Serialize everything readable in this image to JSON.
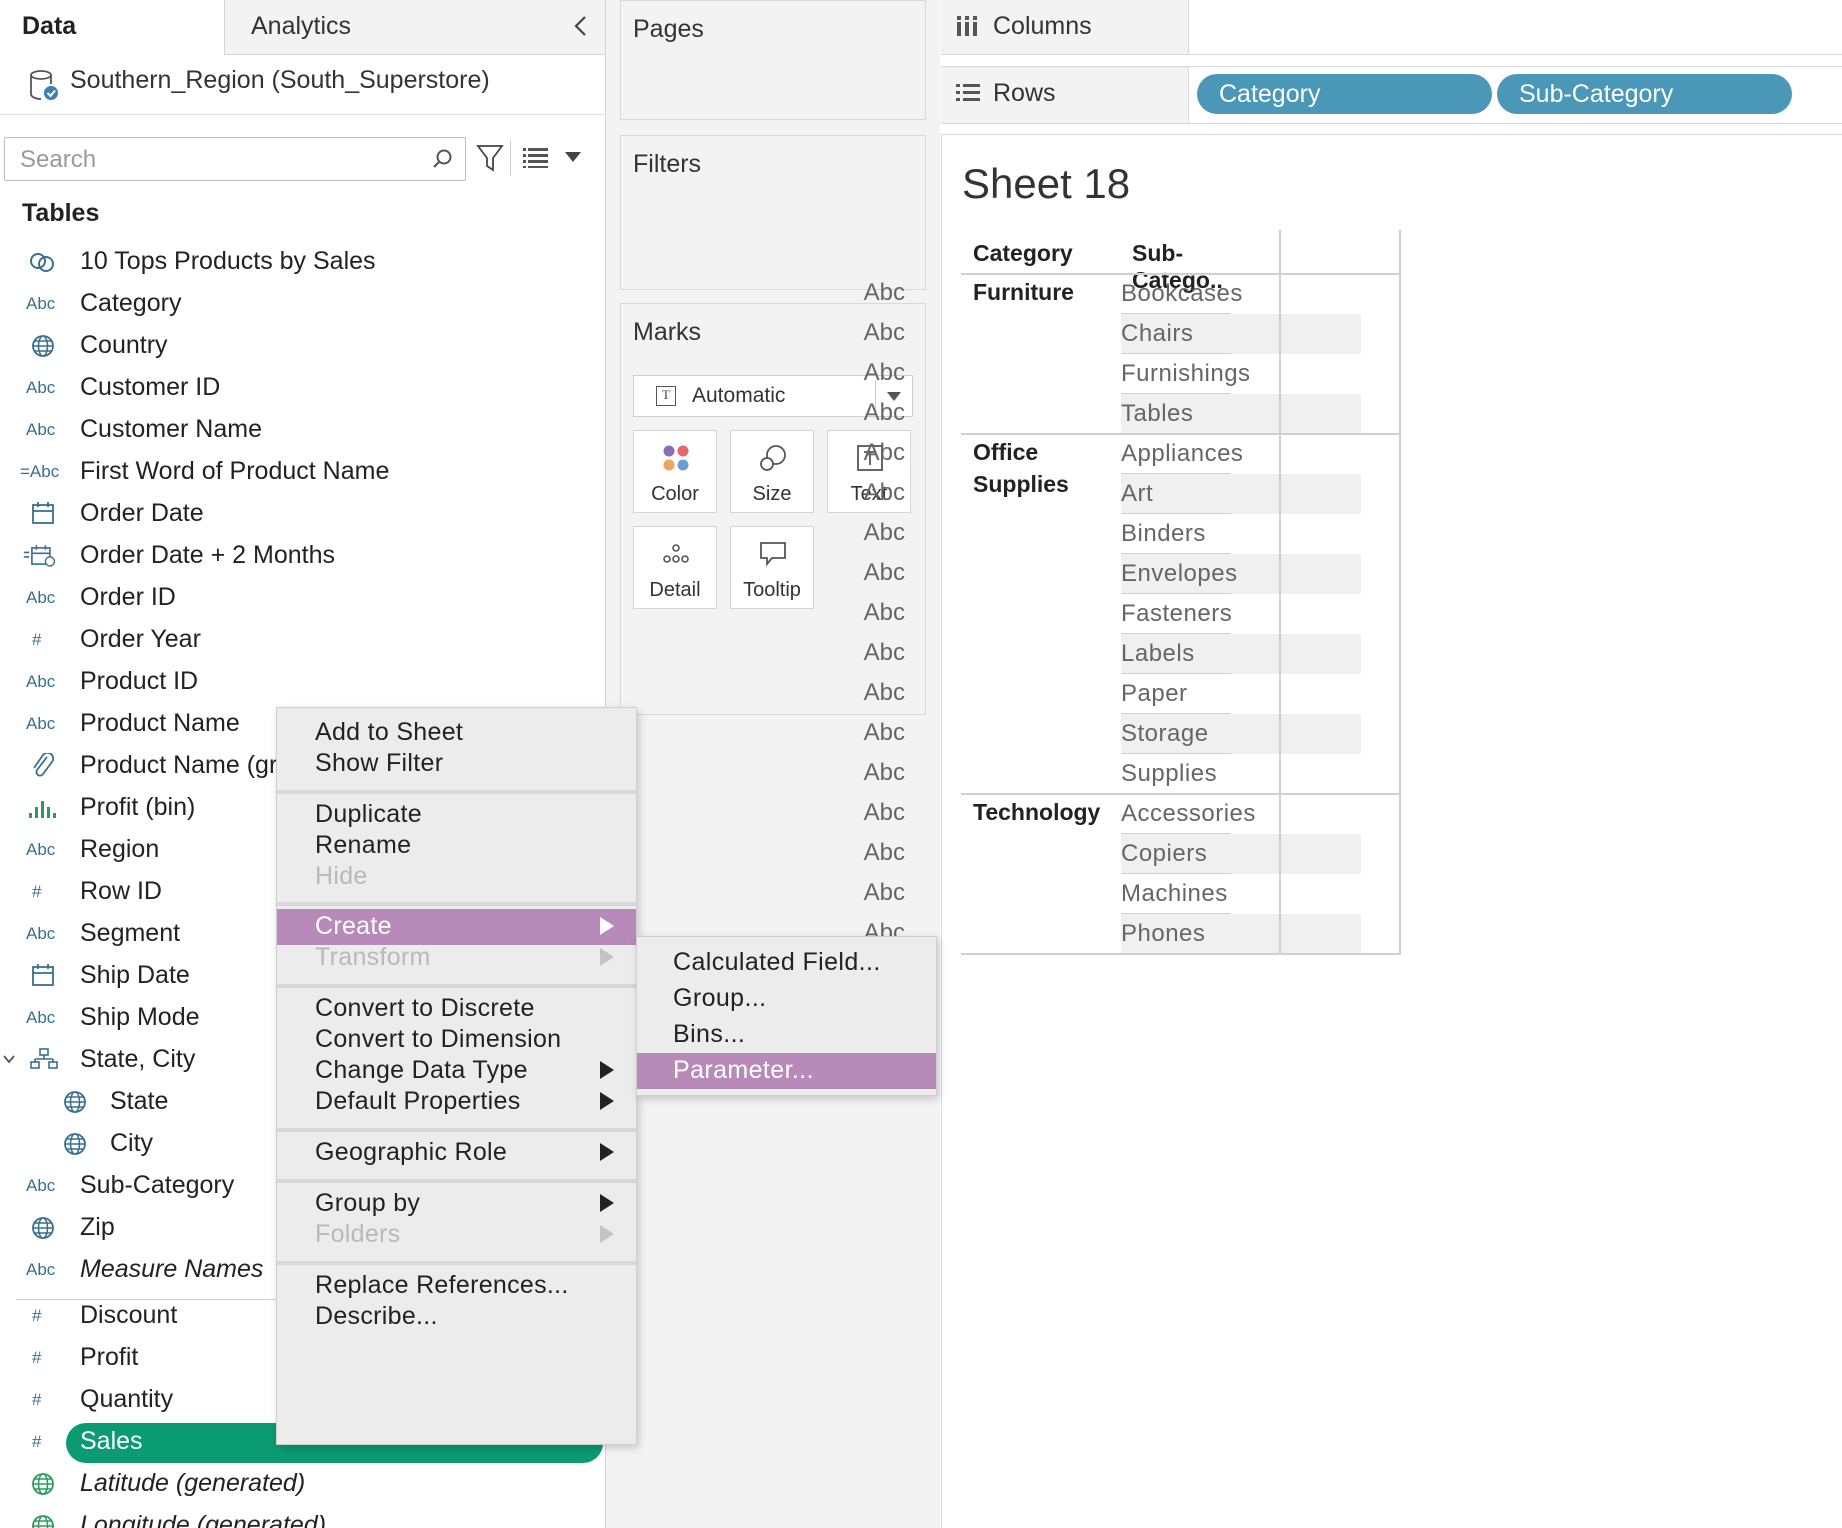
{
  "left_pane": {
    "tabs": {
      "data": "Data",
      "analytics": "Analytics"
    },
    "datasource": "Southern_Region (South_Superstore)",
    "search_placeholder": "Search",
    "tables_heading": "Tables",
    "fields": [
      {
        "icon": "link-icon",
        "label": "10 Tops Products by Sales"
      },
      {
        "icon": "Abc",
        "label": "Category"
      },
      {
        "icon": "globe-icon",
        "label": "Country"
      },
      {
        "icon": "Abc",
        "label": "Customer ID"
      },
      {
        "icon": "Abc",
        "label": "Customer Name"
      },
      {
        "icon": "=Abc",
        "label": "First Word of Product Name"
      },
      {
        "icon": "calendar-icon",
        "label": "Order Date"
      },
      {
        "icon": "calc-calendar-icon",
        "label": "Order Date + 2 Months"
      },
      {
        "icon": "Abc",
        "label": "Order ID"
      },
      {
        "icon": "#",
        "label": "Order Year"
      },
      {
        "icon": "Abc",
        "label": "Product ID"
      },
      {
        "icon": "Abc",
        "label": "Product Name"
      },
      {
        "icon": "paperclip-icon",
        "label": "Product Name (gr"
      },
      {
        "icon": "histogram-icon",
        "label": "Profit (bin)"
      },
      {
        "icon": "Abc",
        "label": "Region"
      },
      {
        "icon": "#",
        "label": "Row ID"
      },
      {
        "icon": "Abc",
        "label": "Segment"
      },
      {
        "icon": "calendar-icon",
        "label": "Ship Date"
      },
      {
        "icon": "Abc",
        "label": "Ship Mode"
      },
      {
        "icon": "hierarchy-icon",
        "label": "State, City"
      },
      {
        "icon": "globe-icon",
        "label": "State"
      },
      {
        "icon": "globe-icon",
        "label": "City"
      },
      {
        "icon": "Abc",
        "label": "Sub-Category"
      },
      {
        "icon": "globe-icon",
        "label": "Zip"
      },
      {
        "icon": "Abc",
        "label": "Measure Names"
      },
      {
        "icon": "#",
        "label": "Discount"
      },
      {
        "icon": "#",
        "label": "Profit"
      },
      {
        "icon": "#",
        "label": "Quantity"
      },
      {
        "icon": "#",
        "label": "Sales"
      },
      {
        "icon": "globe-icon",
        "label": "Latitude (generated)"
      },
      {
        "icon": "globe-icon",
        "label": "Longitude (generated)"
      }
    ]
  },
  "shelves": {
    "pages": "Pages",
    "filters": "Filters",
    "marks": "Marks",
    "mark_type": "Automatic",
    "mark_buttons": {
      "color": "Color",
      "size": "Size",
      "text": "Text",
      "detail": "Detail",
      "tooltip": "Tooltip"
    },
    "columns": "Columns",
    "rows": "Rows",
    "row_pills": [
      "Category",
      "Sub-Category"
    ]
  },
  "viz": {
    "sheet_title": "Sheet 18",
    "headers": [
      "Category",
      "Sub-Catego.."
    ],
    "groups": [
      {
        "category": [
          "Furniture"
        ],
        "subs": [
          "Bookcases",
          "Chairs",
          "Furnishings",
          "Tables"
        ]
      },
      {
        "category": [
          "Office",
          "Supplies"
        ],
        "subs": [
          "Appliances",
          "Art",
          "Binders",
          "Envelopes",
          "Fasteners",
          "Labels",
          "Paper",
          "Storage",
          "Supplies"
        ]
      },
      {
        "category": [
          "Technology"
        ],
        "subs": [
          "Accessories",
          "Copiers",
          "Machines",
          "Phones"
        ]
      }
    ],
    "cell_value": "Abc"
  },
  "context_menu": {
    "items": {
      "add_to_sheet": "Add to Sheet",
      "show_filter": "Show Filter",
      "duplicate": "Duplicate",
      "rename": "Rename",
      "hide": "Hide",
      "create": "Create",
      "transform": "Transform",
      "convert_discrete": "Convert to Discrete",
      "convert_dimension": "Convert to Dimension",
      "change_data_type": "Change Data Type",
      "default_properties": "Default Properties",
      "geographic_role": "Geographic Role",
      "group_by": "Group by",
      "folders": "Folders",
      "replace_references": "Replace References...",
      "describe": "Describe..."
    },
    "submenu": {
      "calculated_field": "Calculated Field...",
      "group": "Group...",
      "bins": "Bins...",
      "parameter": "Parameter..."
    }
  },
  "colors": {
    "pill_blue": "#4b97b8",
    "measure_green": "#0b9b72",
    "menu_highlight": "#b78ab9"
  }
}
